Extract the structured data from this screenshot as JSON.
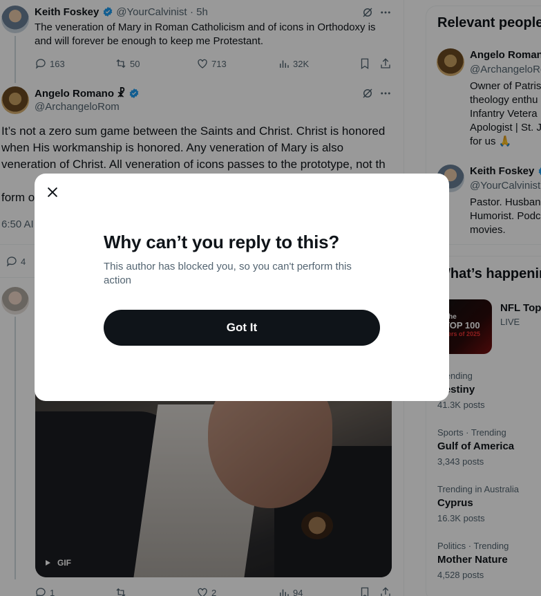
{
  "tweets": {
    "first": {
      "name": "Keith Foskey",
      "handle": "@YourCalvinist",
      "time": "· 5h",
      "text": "The veneration of Mary in Roman Catholicism and of icons in Orthodoxy is and will forever be enough to keep me Protestant.",
      "replies": "163",
      "retweets": "50",
      "likes": "713",
      "views": "32K"
    },
    "second": {
      "name": "Angelo Romano",
      "name_symbol": "☧",
      "handle": "@ArchangeloRom",
      "text": "It’s not a zero sum game between the Saints and Christ. Christ is honored when His workmanship is honored. Any veneration of Mary is also veneration of Christ. All veneration of icons passes to the prototype, not th",
      "text_line5": "form o",
      "time_partial": "6:50 AI",
      "replies_partial": "4"
    },
    "third": {
      "gif_label": "GIF",
      "replies": "1",
      "likes": "2",
      "views": "94"
    }
  },
  "sidebar": {
    "relevant_title": "Relevant people",
    "people": [
      {
        "name": "Angelo Romano",
        "handle": "@ArchangeloRo",
        "bio": [
          "Owner of Patris",
          "theology enthu",
          "Infantry Vetera",
          "Apologist | St. J",
          "for us 🙏"
        ]
      },
      {
        "name": "Keith Foskey",
        "handle": "@YourCalvinist",
        "bio": [
          "Pastor. Husban",
          "Humorist. Podc",
          "movies."
        ]
      }
    ],
    "happening_title": "What’s happenin",
    "nfl": {
      "name": "NFL Top",
      "status": "LIVE",
      "thumb_line1": "The",
      "thumb_line2": "TOP 100",
      "thumb_line3": "vers of 2025"
    },
    "trends": [
      {
        "meta": "Trending",
        "name": "Destiny",
        "posts": "41.3K posts"
      },
      {
        "meta": "Sports · Trending",
        "name": "Gulf of America",
        "posts": "3,343 posts"
      },
      {
        "meta": "Trending in Australia",
        "name": "Cyprus",
        "posts": "16.3K posts"
      },
      {
        "meta": "Politics · Trending",
        "name": "Mother Nature",
        "posts": "4,528 posts"
      }
    ]
  },
  "modal": {
    "title": "Why can’t you reply to this?",
    "description": "This author has blocked you, so you can't perform this action",
    "button": "Got It"
  },
  "colors": {
    "accent": "#1d9bf0",
    "text": "#0f1419",
    "muted": "#536471",
    "overlay": "rgba(0,0,0,0.40)"
  }
}
